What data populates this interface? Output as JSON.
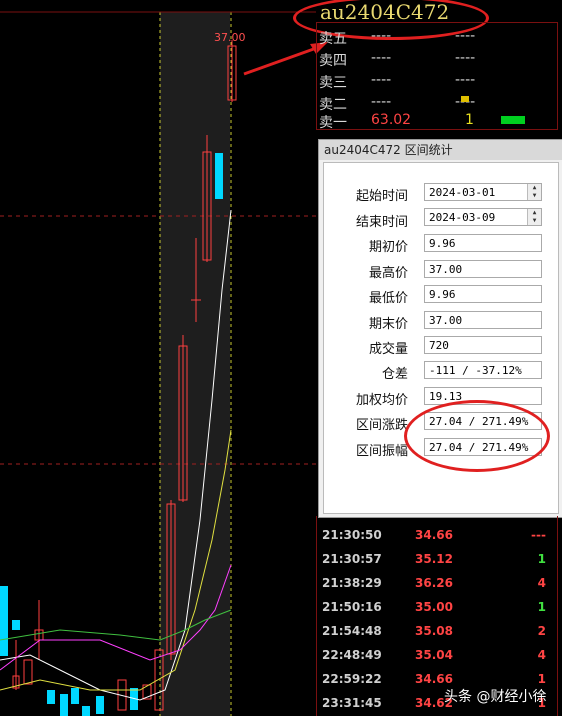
{
  "chart": {
    "top_price_label": "37.00",
    "colors": {
      "up": "#ff4040",
      "down": "#00d8ff",
      "ma_white": "#ffffff",
      "ma_yellow": "#e0e040",
      "ma_magenta": "#ff40ff",
      "ma_green": "#40c040"
    }
  },
  "ticker": "au2404C472",
  "order_book": {
    "rows": [
      {
        "label": "卖五",
        "price": "----",
        "volume": "----"
      },
      {
        "label": "卖四",
        "price": "----",
        "volume": "----"
      },
      {
        "label": "卖三",
        "price": "----",
        "volume": "----"
      },
      {
        "label": "卖二",
        "price": "----",
        "volume": "----"
      },
      {
        "label": "卖一",
        "price": "63.02",
        "volume": "1"
      }
    ]
  },
  "dialog": {
    "title": "au2404C472 区间统计",
    "fields": [
      {
        "label": "起始时间",
        "value": "2024-03-01"
      },
      {
        "label": "结束时间",
        "value": "2024-03-09"
      },
      {
        "label": "期初价",
        "value": "9.96"
      },
      {
        "label": "最高价",
        "value": "37.00"
      },
      {
        "label": "最低价",
        "value": "9.96"
      },
      {
        "label": "期末价",
        "value": "37.00"
      },
      {
        "label": "成交量",
        "value": "720"
      },
      {
        "label": "仓差",
        "value": "-111 / -37.12%"
      },
      {
        "label": "加权均价",
        "value": "19.13"
      },
      {
        "label": "区间涨跌",
        "value": "27.04 / 271.49%"
      },
      {
        "label": "区间振幅",
        "value": "27.04 / 271.49%"
      }
    ]
  },
  "ticks": [
    {
      "time": "21:30:50",
      "price": "34.66",
      "volume": "---",
      "color": "#ff4444"
    },
    {
      "time": "21:30:57",
      "price": "35.12",
      "volume": "1",
      "color": "#40e040"
    },
    {
      "time": "21:38:29",
      "price": "36.26",
      "volume": "4",
      "color": "#ff4444"
    },
    {
      "time": "21:50:16",
      "price": "35.00",
      "volume": "1",
      "color": "#40e040"
    },
    {
      "time": "21:54:48",
      "price": "35.08",
      "volume": "2",
      "color": "#ff4444"
    },
    {
      "time": "22:48:49",
      "price": "35.04",
      "volume": "4",
      "color": "#ff4444"
    },
    {
      "time": "22:59:22",
      "price": "34.66",
      "volume": "1",
      "color": "#ff4444"
    },
    {
      "time": "23:31:45",
      "price": "34.62",
      "volume": "1",
      "color": "#ff4444"
    }
  ],
  "watermark": "头条 @财经小徐"
}
